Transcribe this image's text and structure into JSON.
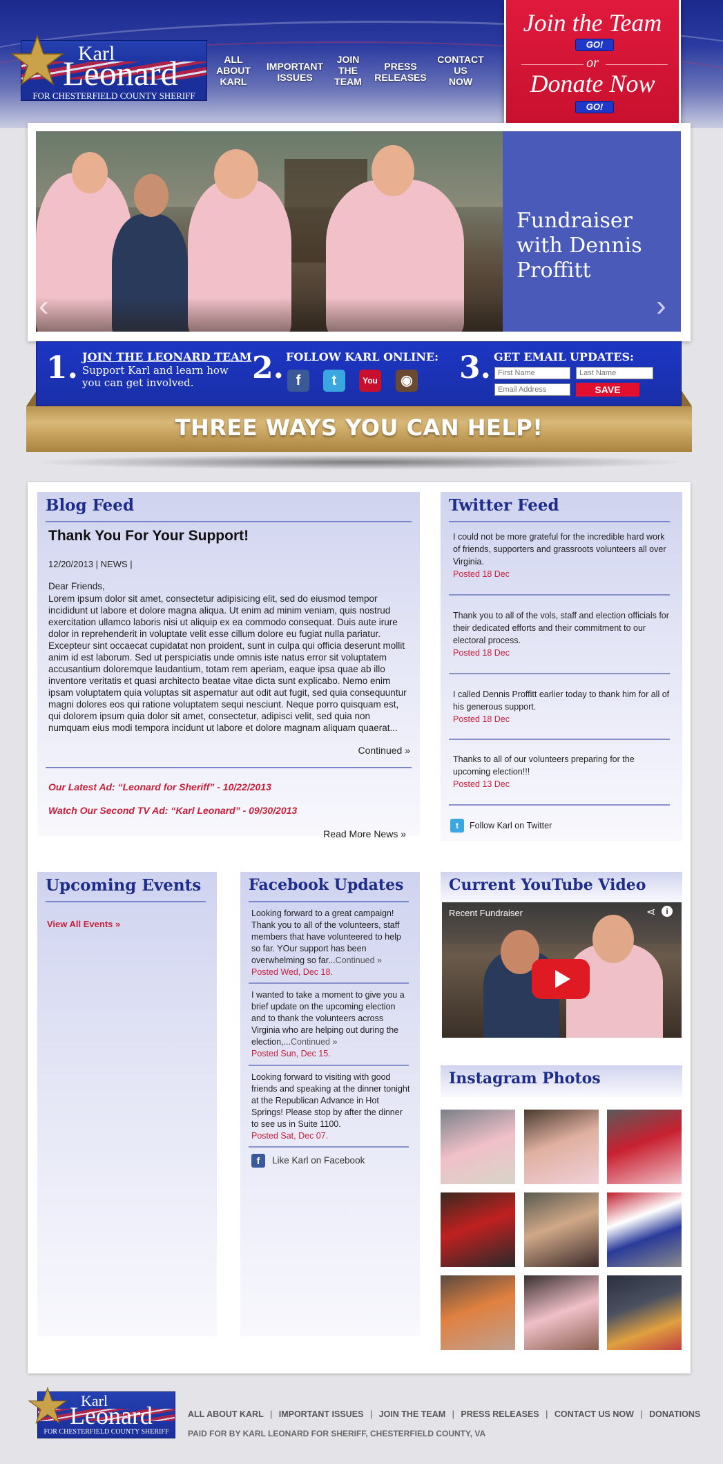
{
  "brand": {
    "karl": "Karl",
    "leonard": "Leonard",
    "subtitle": "FOR CHESTERFIELD COUNTY SHERIFF"
  },
  "nav": [
    {
      "line1": "ALL",
      "line2": "ABOUT",
      "line3": "KARL"
    },
    {
      "line1": "IMPORTANT",
      "line2": "ISSUES",
      "line3": ""
    },
    {
      "line1": "JOIN",
      "line2": "THE",
      "line3": "TEAM"
    },
    {
      "line1": "PRESS",
      "line2": "RELEASES",
      "line3": ""
    },
    {
      "line1": "CONTACT",
      "line2": "US",
      "line3": "NOW"
    }
  ],
  "cta": {
    "join": "Join the Team",
    "go1": "GO!",
    "or": "or",
    "donate": "Donate Now",
    "go2": "GO!"
  },
  "slider": {
    "caption": "Fundraiser with Dennis Proffitt",
    "prev": "‹",
    "next": "›"
  },
  "ways": {
    "n1": "1.",
    "join_title": "JOIN THE LEONARD TEAM",
    "join_text": "Support Karl and learn how you can get involved.",
    "n2": "2.",
    "follow_title": "FOLLOW KARL ONLINE:",
    "n3": "3.",
    "email_title": "GET EMAIL UPDATES:",
    "first_name_placeholder": "First Name",
    "last_name_placeholder": "Last Name",
    "email_placeholder": "Email Address",
    "save": "SAVE",
    "banner": "THREE WAYS YOU CAN HELP!"
  },
  "social_icons": [
    "facebook-icon",
    "twitter-icon",
    "youtube-icon",
    "instagram-icon"
  ],
  "blog": {
    "title": "Blog Feed",
    "post_title": "Thank You For Your Support!",
    "meta": "12/20/2013 | NEWS |",
    "greeting": "Dear Friends,",
    "body": "Lorem ipsum dolor sit amet, consectetur adipisicing elit, sed do eiusmod tempor incididunt ut labore et dolore magna aliqua. Ut enim ad minim veniam, quis nostrud exercitation ullamco laboris nisi ut aliquip ex ea commodo consequat. Duis aute irure dolor in reprehenderit in voluptate velit esse cillum dolore eu fugiat nulla pariatur. Excepteur sint occaecat cupidatat non proident, sunt in culpa qui officia deserunt mollit anim id est laborum. Sed ut perspiciatis unde omnis iste natus error sit voluptatem accusantium doloremque laudantium, totam rem aperiam, eaque ipsa quae ab illo inventore veritatis et quasi architecto beatae vitae dicta sunt explicabo. Nemo enim ipsam voluptatem quia voluptas sit aspernatur aut odit aut fugit, sed quia consequuntur magni dolores eos qui ratione voluptatem sequi nesciunt. Neque porro quisquam est, qui dolorem ipsum quia dolor sit amet, consectetur, adipisci velit, sed quia non numquam eius modi tempora incidunt ut labore et dolore magnam aliquam quaerat...",
    "continued": "Continued »",
    "link1": "Our Latest Ad: “Leonard for Sheriff” - 10/22/2013",
    "link2": "Watch Our Second TV Ad: “Karl Leonard” - 09/30/2013",
    "read_more": "Read More News »"
  },
  "twitter": {
    "title": "Twitter Feed",
    "tweets": [
      {
        "text": "I could not be more grateful for the incredible hard work of friends, supporters and grassroots volunteers all over Virginia.",
        "posted": "Posted 18 Dec"
      },
      {
        "text": "Thank you to all of the vols, staff and election officials for their dedicated efforts and their commitment to our electoral process.",
        "posted": "Posted 18 Dec"
      },
      {
        "text": "I called Dennis Proffitt earlier today to thank him for all of his generous support.",
        "posted": "Posted 18 Dec"
      },
      {
        "text": "Thanks to all of our volunteers preparing for the upcoming election!!!",
        "posted": "Posted 13 Dec"
      }
    ],
    "follow": "Follow Karl on Twitter"
  },
  "events": {
    "title": "Upcoming Events",
    "view_all": "View All Events »"
  },
  "facebook": {
    "title": "Facebook Updates",
    "posts": [
      {
        "text": "Looking forward to a great campaign! Thank you to all of the volunteers, staff members that have volunteered to help so far. YOur support has been overwhelming so far...",
        "continued": "Continued »",
        "posted": "Posted Wed, Dec 18."
      },
      {
        "text": "I wanted to take a moment to give you a brief update on the upcoming election and to thank the volunteers across Virginia who are helping out during the election,...",
        "continued": "Continued »",
        "posted": "Posted Sun, Dec 15."
      },
      {
        "text": "Looking forward to visiting with good friends and speaking at the dinner tonight at the Republican Advance in Hot Springs! Please stop by after the dinner to see us in Suite 1100.",
        "continued": "",
        "posted": "Posted Sat, Dec 07."
      }
    ],
    "like": "Like Karl on Facebook"
  },
  "youtube": {
    "title": "Current YouTube Video",
    "video_title": "Recent Fundraiser"
  },
  "instagram": {
    "title": "Instagram Photos"
  },
  "footer": {
    "links": [
      "ALL ABOUT KARL",
      "IMPORTANT ISSUES",
      "JOIN THE TEAM",
      "PRESS RELEASES",
      "CONTACT US NOW",
      "DONATIONS"
    ],
    "separator": "|",
    "paid": "PAID FOR BY KARL LEONARD FOR SHERIFF, CHESTERFIELD COUNTY, VA"
  },
  "colors": {
    "brand_blue": "#1e2c8a",
    "accent_red": "#c8203a",
    "caption_blue": "#4a5ab8",
    "banner_gold": "#c9a460"
  }
}
